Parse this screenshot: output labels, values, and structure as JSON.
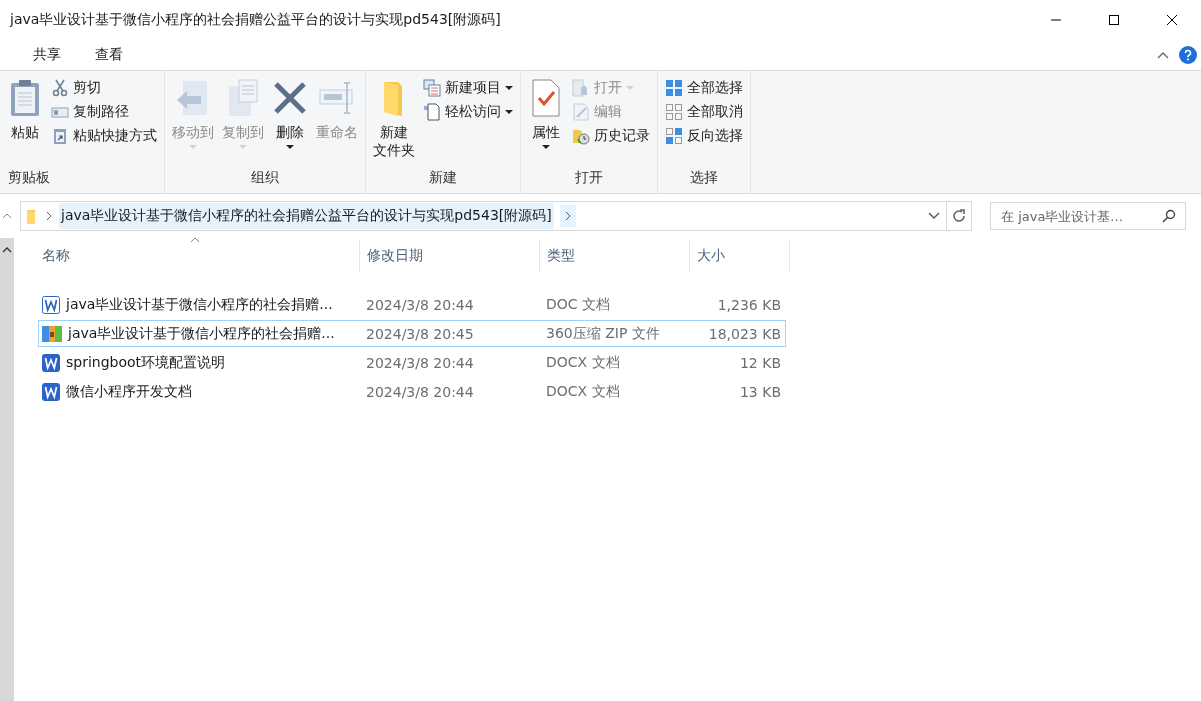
{
  "window": {
    "title": "java毕业设计基于微信小程序的社会捐赠公益平台的设计与实现pd543[附源码]"
  },
  "ribbon_tabs": [
    {
      "label": "共享",
      "selected": false
    },
    {
      "label": "查看",
      "selected": false
    }
  ],
  "ribbon": [
    {
      "label": "剪贴板",
      "items": [
        {
          "label": "粘贴",
          "kind": "large",
          "disabled": false,
          "dropdown": false
        },
        {
          "label": "剪切",
          "kind": "small",
          "disabled": false,
          "dropdown": false
        },
        {
          "label": "复制路径",
          "kind": "small",
          "disabled": false,
          "dropdown": false
        },
        {
          "label": "粘贴快捷方式",
          "kind": "small",
          "disabled": false,
          "dropdown": false
        }
      ]
    },
    {
      "label": "组织",
      "items": [
        {
          "label": "移动到",
          "kind": "large",
          "disabled": true,
          "dropdown": true
        },
        {
          "label": "复制到",
          "kind": "large",
          "disabled": true,
          "dropdown": true
        },
        {
          "label": "删除",
          "kind": "large",
          "disabled": false,
          "dropdown": true
        },
        {
          "label": "重命名",
          "kind": "large",
          "disabled": true,
          "dropdown": false
        }
      ]
    },
    {
      "label": "新建",
      "items": [
        {
          "lines": [
            "新建",
            "文件夹"
          ],
          "kind": "large",
          "disabled": false,
          "dropdown": false
        },
        {
          "label": "新建项目",
          "kind": "small",
          "disabled": false,
          "dropdown": true
        },
        {
          "label": "轻松访问",
          "kind": "small",
          "disabled": false,
          "dropdown": true
        }
      ]
    },
    {
      "label": "打开",
      "items": [
        {
          "label": "属性",
          "kind": "large",
          "disabled": false,
          "dropdown": true
        },
        {
          "label": "打开",
          "kind": "small",
          "disabled": true,
          "dropdown": true
        },
        {
          "label": "编辑",
          "kind": "small",
          "disabled": true,
          "dropdown": false
        },
        {
          "label": "历史记录",
          "kind": "small",
          "disabled": false,
          "dropdown": false
        }
      ]
    },
    {
      "label": "选择",
      "items": [
        {
          "label": "全部选择",
          "kind": "small",
          "disabled": false,
          "dropdown": false
        },
        {
          "label": "全部取消",
          "kind": "small",
          "disabled": false,
          "dropdown": false
        },
        {
          "label": "反向选择",
          "kind": "small",
          "disabled": false,
          "dropdown": false
        }
      ]
    }
  ],
  "address": {
    "path": [
      {
        "label": "java毕业设计基于微信小程序的社会捐赠公益平台的设计与实现pd543[附源码]",
        "selected": true
      }
    ]
  },
  "search": {
    "placeholder": "在 java毕业设计基..."
  },
  "table": {
    "columns": [
      {
        "label": "名称",
        "sorted": true
      },
      {
        "label": "修改日期",
        "sorted": false
      },
      {
        "label": "类型",
        "sorted": false
      },
      {
        "label": "大小",
        "sorted": false
      }
    ],
    "rows": [
      {
        "kind": "doc",
        "name": "java毕业设计基于微信小程序的社会捐赠...",
        "date": "2024/3/8 20:44",
        "type": "DOC 文档",
        "size": "1,236 KB",
        "focused": false
      },
      {
        "kind": "zip",
        "name": "java毕业设计基于微信小程序的社会捐赠...",
        "date": "2024/3/8 20:45",
        "type": "360压缩 ZIP 文件",
        "size": "18,023 KB",
        "focused": true
      },
      {
        "kind": "docx",
        "name": "springboot环境配置说明",
        "date": "2024/3/8 20:44",
        "type": "DOCX 文档",
        "size": "12 KB",
        "focused": false
      },
      {
        "kind": "docx",
        "name": "微信小程序开发文档",
        "date": "2024/3/8 20:44",
        "type": "DOCX 文档",
        "size": "13 KB",
        "focused": false
      }
    ]
  }
}
